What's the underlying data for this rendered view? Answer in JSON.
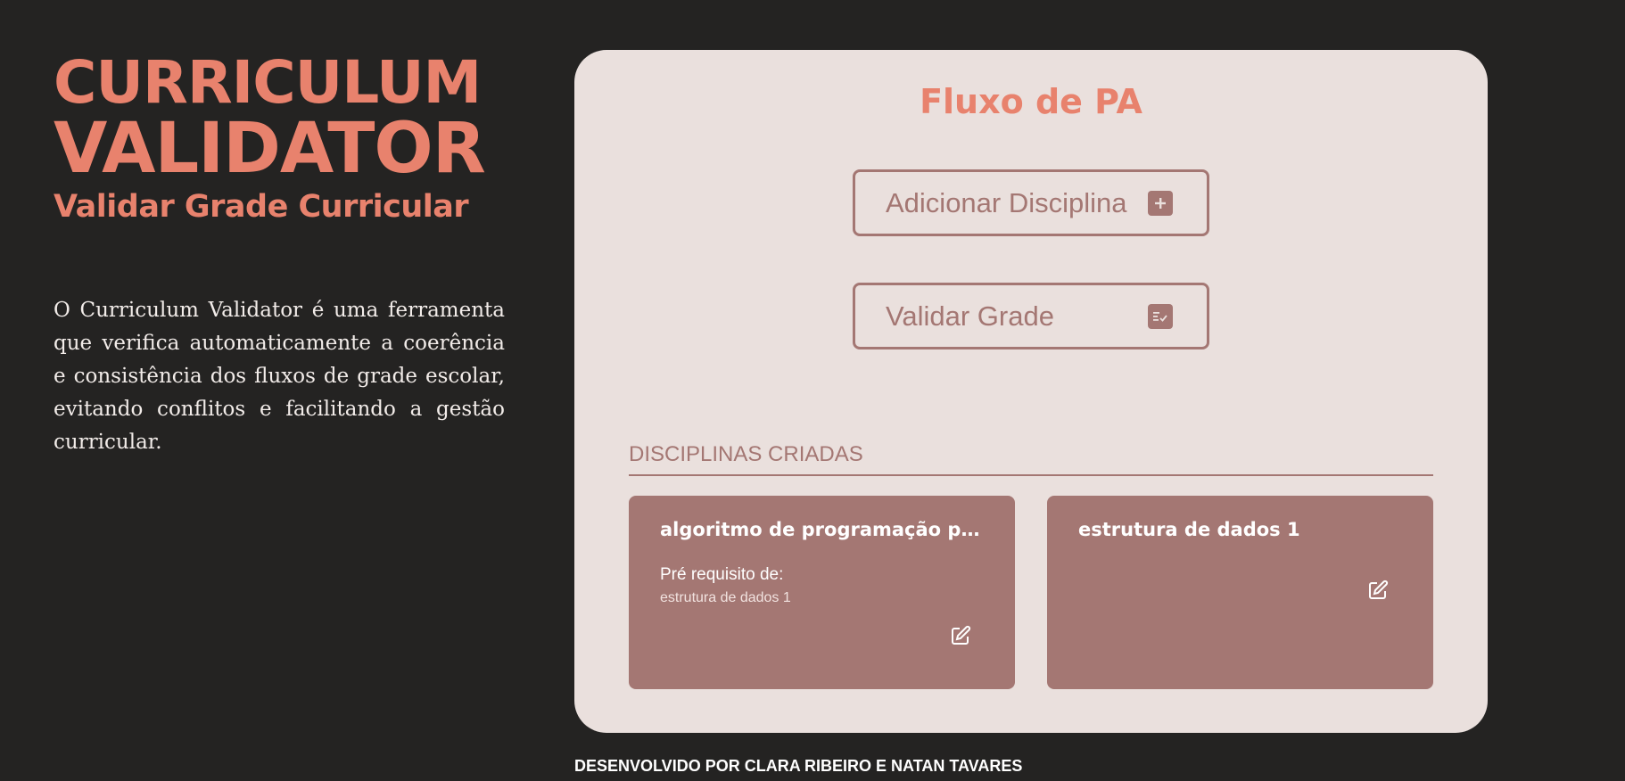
{
  "brand": {
    "line1": "CURRICULUM",
    "line2": "VALIDATOR",
    "subtitle": "Validar Grade Curricular"
  },
  "description": "O Curriculum Validator é uma ferramenta que verifica automaticamente a coerência e consistência dos fluxos de grade escolar, evitando conflitos e facilitando a gestão curricular.",
  "panel": {
    "title": "Fluxo de PA",
    "add_button": "Adicionar Disciplina",
    "validate_button": "Validar Grade",
    "section_label": "DISCIPLINAS CRIADAS"
  },
  "cards": [
    {
      "title": "algoritmo de programação para ...",
      "prereq_label": "Pré requisito de:",
      "prereq_value": "estrutura de dados 1"
    },
    {
      "title": "estrutura de dados 1"
    }
  ],
  "footer": "DESENVOLVIDO POR CLARA RIBEIRO E NATAN TAVARES",
  "colors": {
    "background": "#242322",
    "accent": "#e8826d",
    "panel": "#eae0dd",
    "card": "#a47773"
  },
  "icons": {
    "add": "plus-square-icon",
    "validate": "checklist-icon",
    "edit": "edit-icon"
  }
}
